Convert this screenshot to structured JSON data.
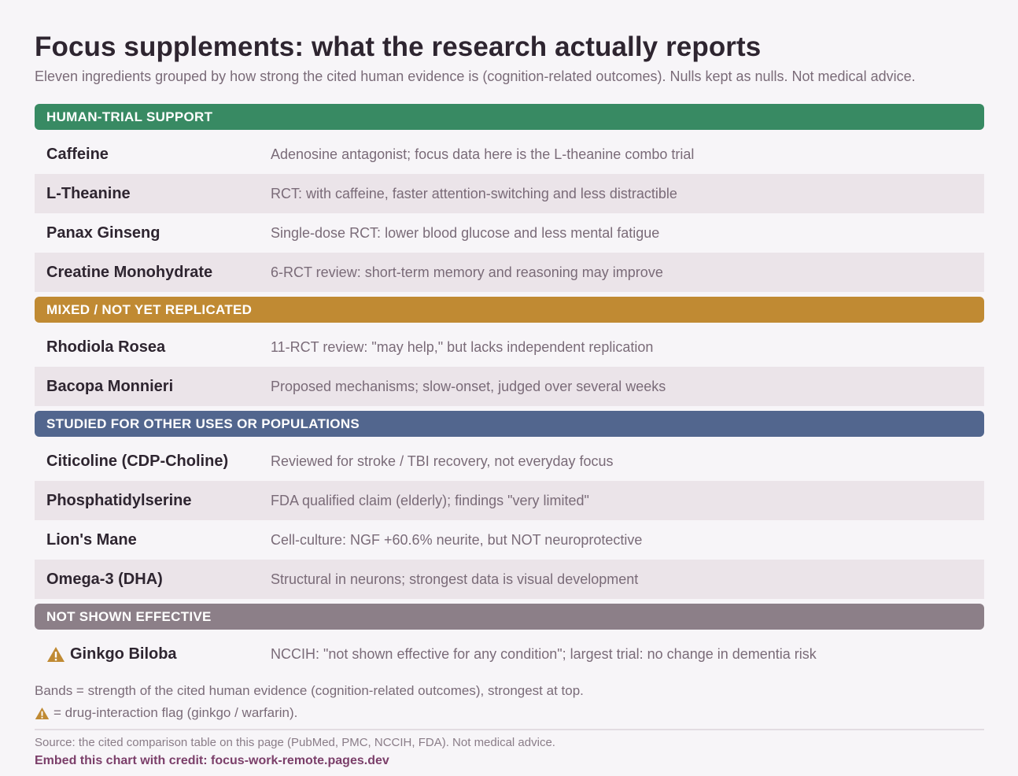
{
  "title": "Focus supplements: what the research actually reports",
  "subtitle": "Eleven ingredients grouped by how strong the cited human evidence is (cognition-related outcomes). Nulls kept as nulls. Not medical advice.",
  "bands": [
    {
      "label": "HUMAN-TRIAL SUPPORT",
      "color": "#388a63",
      "rows": [
        {
          "name": "Caffeine",
          "desc": "Adenosine antagonist; focus data here is the L-theanine combo trial"
        },
        {
          "name": "L-Theanine",
          "desc": "RCT: with caffeine, faster attention-switching and less distractible"
        },
        {
          "name": "Panax Ginseng",
          "desc": "Single-dose RCT: lower blood glucose and less mental fatigue"
        },
        {
          "name": "Creatine Monohydrate",
          "desc": "6-RCT review: short-term memory and reasoning may improve"
        }
      ]
    },
    {
      "label": "MIXED / NOT YET REPLICATED",
      "color": "#c08a33",
      "rows": [
        {
          "name": "Rhodiola Rosea",
          "desc": "11-RCT review: \"may help,\" but lacks independent replication"
        },
        {
          "name": "Bacopa Monnieri",
          "desc": "Proposed mechanisms; slow-onset, judged over several weeks"
        }
      ]
    },
    {
      "label": "STUDIED FOR OTHER USES OR POPULATIONS",
      "color": "#52668e",
      "rows": [
        {
          "name": "Citicoline (CDP-Choline)",
          "desc": "Reviewed for stroke / TBI recovery, not everyday focus"
        },
        {
          "name": "Phosphatidylserine",
          "desc": "FDA qualified claim (elderly); findings \"very limited\""
        },
        {
          "name": "Lion's Mane",
          "desc": "Cell-culture: NGF +60.6% neurite, but NOT neuroprotective"
        },
        {
          "name": "Omega-3 (DHA)",
          "desc": "Structural in neurons; strongest data is visual development"
        }
      ]
    },
    {
      "label": "NOT SHOWN EFFECTIVE",
      "color": "#8c7f88",
      "rows": [
        {
          "name": "Ginkgo Biloba",
          "desc": "NCCIH: \"not shown effective for any condition\"; largest trial: no change in dementia risk",
          "flag": "warning-icon"
        }
      ]
    }
  ],
  "notes": {
    "bands_note": "Bands = strength of the cited human evidence (cognition-related outcomes), strongest at top.",
    "flag_note": "= drug-interaction flag (ginkgo / warfarin).",
    "flag_icon": "warning-icon",
    "flag_color": "#c08a33"
  },
  "source": "Source: the cited comparison table on this page (PubMed, PMC, NCCIH, FDA). Not medical advice.",
  "credit": "Embed this chart with credit: focus-work-remote.pages.dev"
}
